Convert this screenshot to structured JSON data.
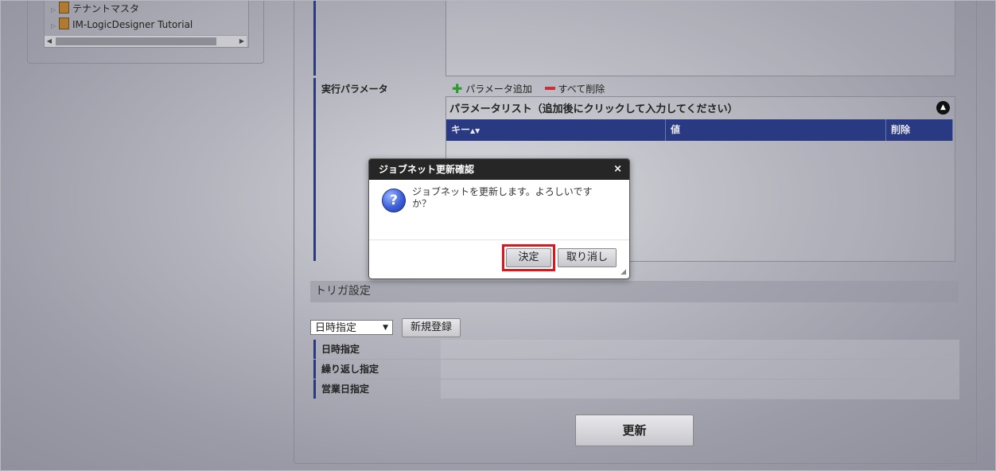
{
  "tree": {
    "items": [
      {
        "label": "テナントマスタ"
      },
      {
        "label": "IM-LogicDesigner Tutorial"
      }
    ]
  },
  "form": {
    "exec_param_label": "実行パラメータ",
    "add_param_label": "パラメータ追加",
    "delete_all_label": "すべて削除",
    "param_list_title": "パラメータリスト（追加後にクリックして入力してください）",
    "columns": {
      "key": "キー",
      "value": "値",
      "delete": "削除"
    }
  },
  "trigger": {
    "section_title": "トリガ設定",
    "select_value": "日時指定",
    "new_button": "新規登録",
    "rows": [
      {
        "label": "日時指定"
      },
      {
        "label": "繰り返し指定"
      },
      {
        "label": "営業日指定"
      }
    ]
  },
  "update_button": "更新",
  "dialog": {
    "title": "ジョブネット更新確認",
    "close_glyph": "×",
    "message_line1": "ジョブネットを更新します。よろしいです",
    "message_line2": "か？",
    "ok_label": "決定",
    "cancel_label": "取り消し"
  },
  "icons": {
    "question": "?",
    "sort": "▲▼",
    "collapse": "▲"
  },
  "colors": {
    "table_header": "#2a3a82",
    "dialog_title": "#262626",
    "highlight": "#e0141c",
    "add_icon": "#2a9a2a",
    "remove_icon": "#c8303a"
  }
}
